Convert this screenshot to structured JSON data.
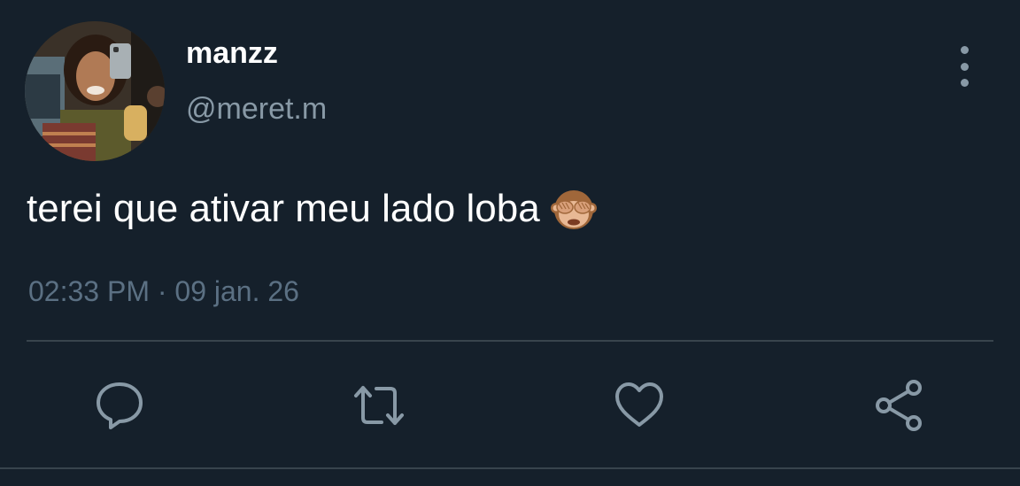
{
  "user": {
    "display_name": "manzz",
    "handle": "@meret.m"
  },
  "tweet": {
    "text": "terei que ativar meu lado loba",
    "emoji": "see-no-evil-monkey",
    "timestamp": "02:33 PM · 09 jan. 26"
  },
  "actions": [
    {
      "name": "reply",
      "icon": "speech-bubble-icon"
    },
    {
      "name": "retweet",
      "icon": "retweet-icon"
    },
    {
      "name": "like",
      "icon": "heart-icon"
    },
    {
      "name": "share",
      "icon": "share-icon"
    }
  ],
  "colors": {
    "background": "#15202b",
    "primary_text": "#ffffff",
    "secondary_text": "#8899a6",
    "timestamp_text": "#5b7083",
    "divider": "#38444d"
  }
}
